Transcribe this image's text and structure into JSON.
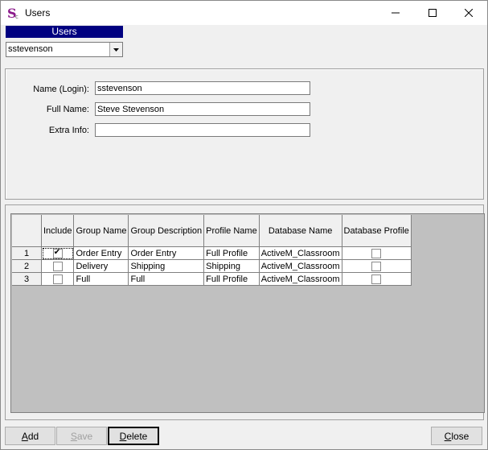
{
  "window": {
    "title": "Users",
    "app_icon": "stylized-s-app-icon",
    "controls": [
      "minimize-icon",
      "maximize-icon",
      "close-icon"
    ]
  },
  "users": {
    "header": "Users",
    "selected": "sstevenson"
  },
  "form": {
    "login_label": "Name (Login):",
    "login_value": "sstevenson",
    "fullname_label": "Full Name:",
    "fullname_value": "Steve Stevenson",
    "extra_label": "Extra Info:",
    "extra_value": ""
  },
  "grid": {
    "columns": [
      "Include",
      "Group Name",
      "Group Description",
      "Profile Name",
      "Database Name",
      "Database Profile"
    ],
    "rows": [
      {
        "num": "1",
        "include": true,
        "group": "Order Entry",
        "desc": "Order Entry",
        "profile": "Full Profile",
        "db": "ActiveM_Classroom",
        "db_profile": false
      },
      {
        "num": "2",
        "include": false,
        "group": "Delivery",
        "desc": "Shipping",
        "profile": "Shipping",
        "db": "ActiveM_Classroom",
        "db_profile": false
      },
      {
        "num": "3",
        "include": false,
        "group": "Full",
        "desc": "Full",
        "profile": "Full Profile",
        "db": "ActiveM_Classroom",
        "db_profile": false
      }
    ]
  },
  "buttons": {
    "add_hot": "A",
    "add_rest": "dd",
    "save_hot": "S",
    "save_rest": "ave",
    "delete_hot": "D",
    "delete_rest": "elete",
    "close_hot": "C",
    "close_rest": "lose"
  },
  "colors": {
    "header_bg": "#000080",
    "window_bg": "#f0f0f0",
    "grid_bg": "#c0c0c0",
    "app_icon": "#8b1a8b"
  }
}
